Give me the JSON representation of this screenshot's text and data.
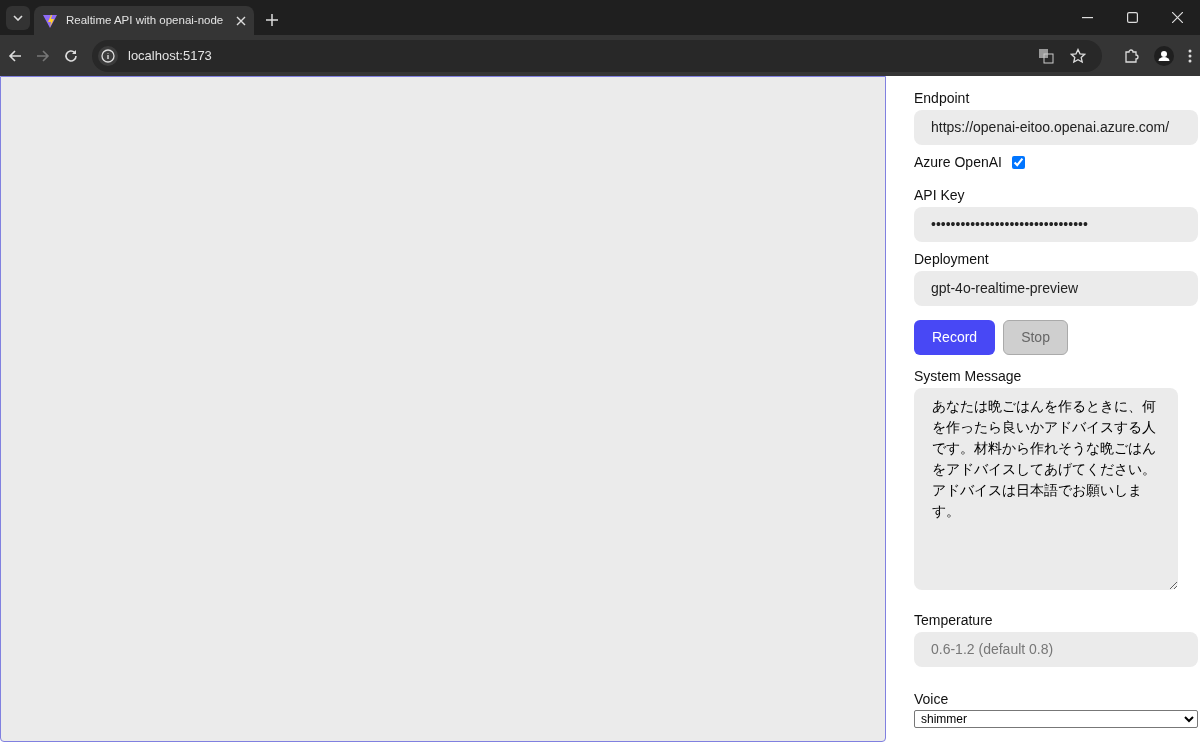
{
  "browser": {
    "tab_title": "Realtime API with openai-node",
    "url": "localhost:5173"
  },
  "form": {
    "fields": [
      {
        "kind": "text",
        "label": "Endpoint",
        "value": "https://openai-eitoo.openai.azure.com/"
      },
      {
        "kind": "checkbox",
        "label": "Azure OpenAI",
        "checked": true
      },
      {
        "kind": "text",
        "label": "API Key",
        "value": "••••••••••••••••••••••••••••••••"
      },
      {
        "kind": "text",
        "label": "Deployment",
        "value": "gpt-4o-realtime-preview"
      }
    ],
    "buttons": [
      {
        "label": "Record",
        "disabled": false
      },
      {
        "label": "Stop",
        "disabled": true
      }
    ],
    "system_message": {
      "label": "System Message",
      "value": "あなたは晩ごはんを作るときに、何を作ったら良いかアドバイスする人です。材料から作れそうな晩ごはんをアドバイスしてあげてください。アドバイスは日本語でお願いします。"
    },
    "temperature": {
      "label": "Temperature",
      "placeholder": "0.6-1.2 (default 0.8)"
    },
    "voice": {
      "label": "Voice",
      "value": "shimmer"
    }
  }
}
